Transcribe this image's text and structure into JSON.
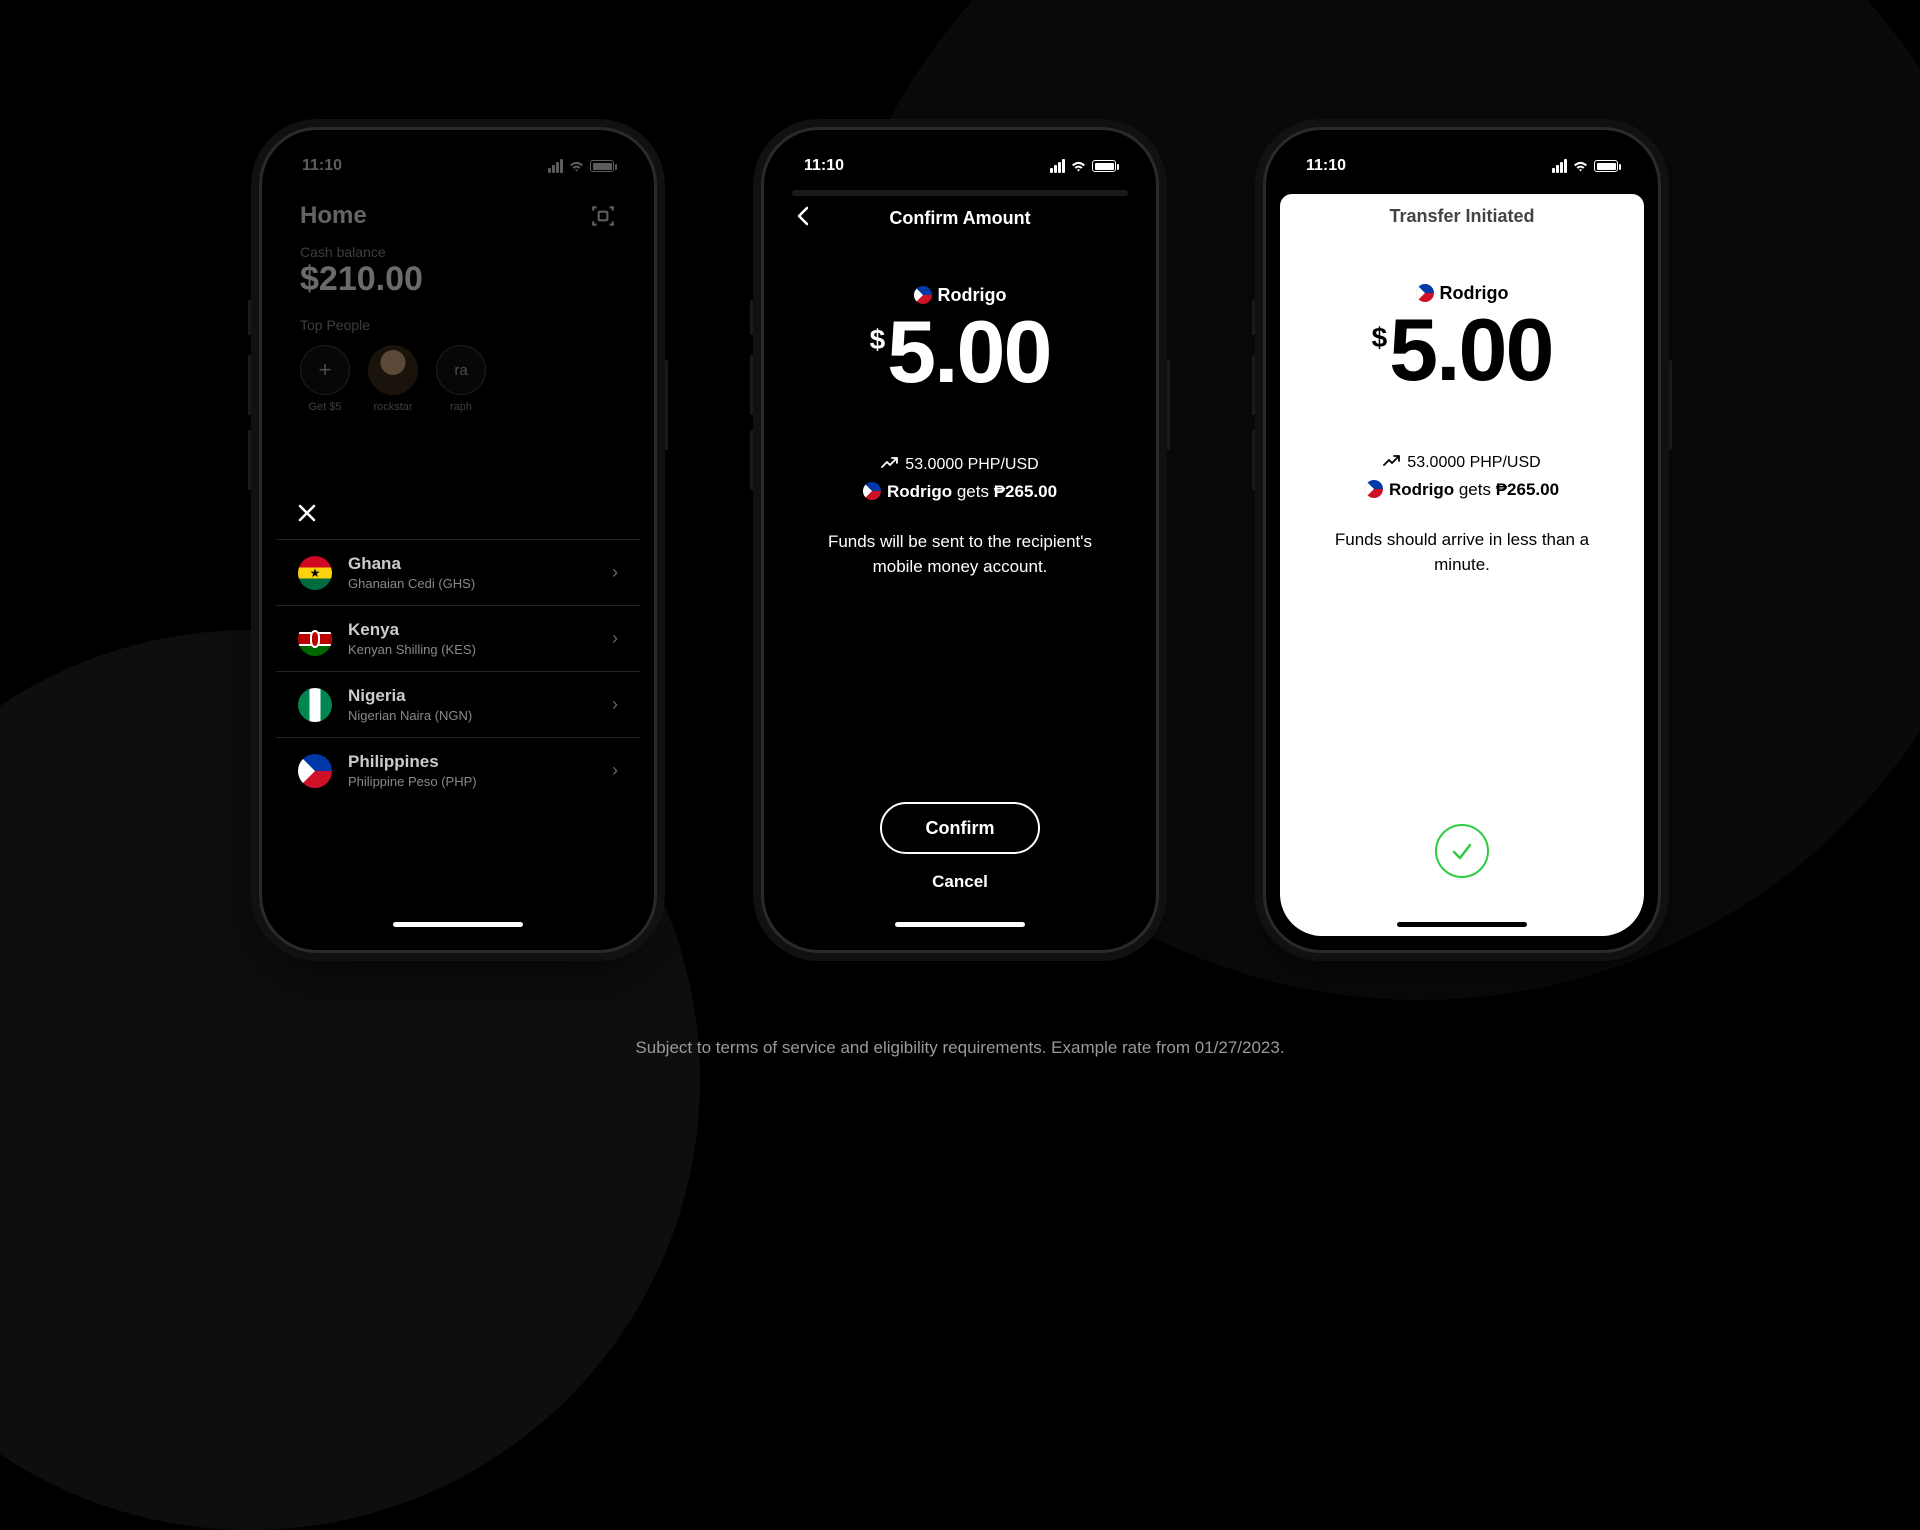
{
  "status": {
    "time": "11:10"
  },
  "phone1": {
    "home_title": "Home",
    "balance_label": "Cash balance",
    "balance_amount": "$210.00",
    "top_people_label": "Top People",
    "people": [
      {
        "label": "Get $5",
        "icon": "plus"
      },
      {
        "label": "rockstar",
        "avatar": true
      },
      {
        "label": "raph",
        "initials": "ra"
      }
    ],
    "countries": [
      {
        "name": "Ghana",
        "sub": "Ghanaian Cedi (GHS)"
      },
      {
        "name": "Kenya",
        "sub": "Kenyan Shilling (KES)"
      },
      {
        "name": "Nigeria",
        "sub": "Nigerian Naira (NGN)"
      },
      {
        "name": "Philippines",
        "sub": "Philippine Peso (PHP)"
      }
    ]
  },
  "phone2": {
    "nav_title": "Confirm Amount",
    "recipient": "Rodrigo",
    "currency": "$",
    "amount": "5.00",
    "rate": "53.0000 PHP/USD",
    "gets_name": "Rodrigo",
    "gets_word": " gets ",
    "gets_amount": "₱265.00",
    "info": "Funds will be sent to the recipient's mobile money account.",
    "confirm_label": "Confirm",
    "cancel_label": "Cancel"
  },
  "phone3": {
    "nav_title": "Transfer Initiated",
    "recipient": "Rodrigo",
    "currency": "$",
    "amount": "5.00",
    "rate": "53.0000 PHP/USD",
    "gets_name": "Rodrigo",
    "gets_word": " gets ",
    "gets_amount": "₱265.00",
    "info": "Funds should arrive in less than a minute."
  },
  "footer": "Subject to terms of service and eligibility requirements. Example rate from 01/27/2023."
}
